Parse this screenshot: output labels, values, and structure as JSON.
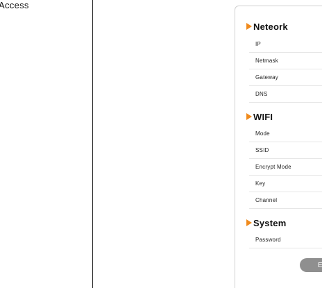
{
  "sidebar": {
    "access_label": "Access"
  },
  "colors": {
    "accent_arrow": "#f08a1c",
    "button_bg": "#8f8f8f"
  },
  "sections": {
    "network": {
      "title": "Neteork",
      "fields": [
        "IP",
        "Netmask",
        "Gateway",
        "DNS"
      ]
    },
    "wifi": {
      "title": "WIFI",
      "fields": [
        "Mode",
        "SSID",
        "Encrypt Mode",
        "Key",
        "Channel"
      ]
    },
    "system": {
      "title": "System",
      "fields": [
        "Password"
      ]
    }
  },
  "actions": {
    "edit_label": "E"
  },
  "icons": {
    "section_marker": "triangle-right-icon"
  }
}
